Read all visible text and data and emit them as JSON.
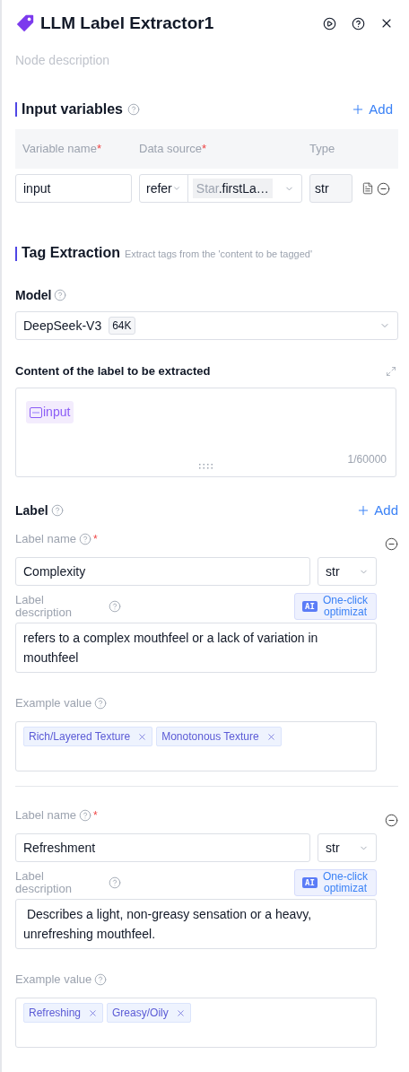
{
  "header": {
    "title": "LLM Label Extractor1",
    "description_placeholder": "Node description"
  },
  "input_variables": {
    "title": "Input variables",
    "add": "Add",
    "columns": [
      {
        "label": "Variable name",
        "required_mark": "*"
      },
      {
        "label": "Data source",
        "required_mark": "*"
      },
      {
        "label": "Type"
      }
    ],
    "rows": [
      {
        "name": "input",
        "source_mode": "refer",
        "source_node": "Star",
        "source_field": ".firstLa…",
        "type": "str"
      }
    ]
  },
  "tag_extraction": {
    "title": "Tag Extraction",
    "hint": "Extract tags from the 'content to be tagged'"
  },
  "model": {
    "label": "Model",
    "name": "DeepSeek-V3",
    "context": "64K"
  },
  "content": {
    "label": "Content of the label to be extracted",
    "variable": "input",
    "counter": "1/60000"
  },
  "labels": {
    "title": "Label",
    "add": "Add",
    "items": [
      {
        "name_caption": "Label name",
        "name_required_mark": "*",
        "name": "Complexity",
        "type": "str",
        "description_caption": "Label description",
        "ai_badge": "AI",
        "ai_text": "One-click optimizat",
        "description": "refers to a complex mouthfeel or a lack of variation in mouthfeel",
        "example_caption": "Example value",
        "examples": [
          "Rich/Layered Texture",
          "Monotonous Texture"
        ]
      },
      {
        "name_caption": "Label name",
        "name_required_mark": "*",
        "name": "Refreshment",
        "type": "str",
        "description_caption": "Label description",
        "ai_badge": "AI",
        "ai_text": "One-click optimizat",
        "description": " Describes a light, non-greasy sensation or a heavy, unrefreshing mouthfeel.",
        "example_caption": "Example value",
        "examples": [
          "Refreshing",
          "Greasy/Oily"
        ]
      }
    ]
  }
}
